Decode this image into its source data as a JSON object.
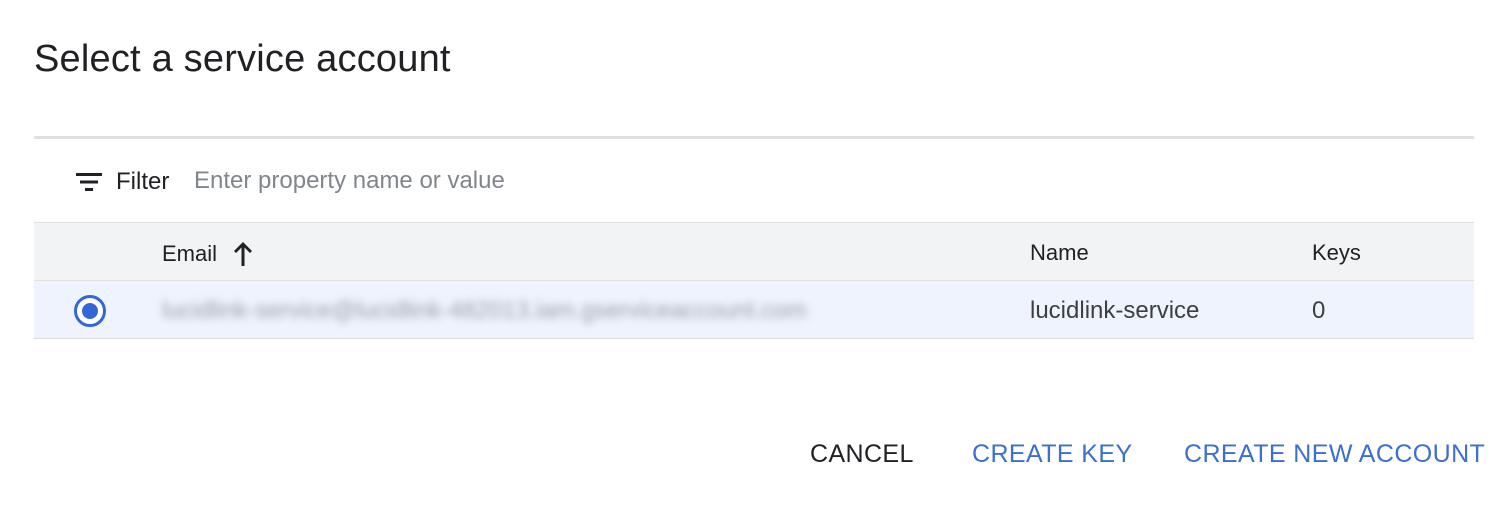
{
  "dialog": {
    "title": "Select a service account"
  },
  "filter": {
    "label": "Filter",
    "placeholder": "Enter property name or value",
    "value": ""
  },
  "table": {
    "columns": {
      "email": "Email",
      "name": "Name",
      "keys": "Keys"
    },
    "sort": {
      "column": "Email",
      "direction": "ascending"
    },
    "rows": [
      {
        "selected": true,
        "email": "lucidlink-service@lucidlink-482013.iam.gserviceaccount.com",
        "name": "lucidlink-service",
        "keys": "0"
      }
    ]
  },
  "actions": {
    "cancel": "CANCEL",
    "create_key": "CREATE KEY",
    "create_new_account": "CREATE NEW ACCOUNT"
  },
  "colors": {
    "accent": "#3367d6",
    "link": "#3c6fd1",
    "header_bg": "#f1f3f4",
    "selected_row_bg": "#eef3fd"
  }
}
